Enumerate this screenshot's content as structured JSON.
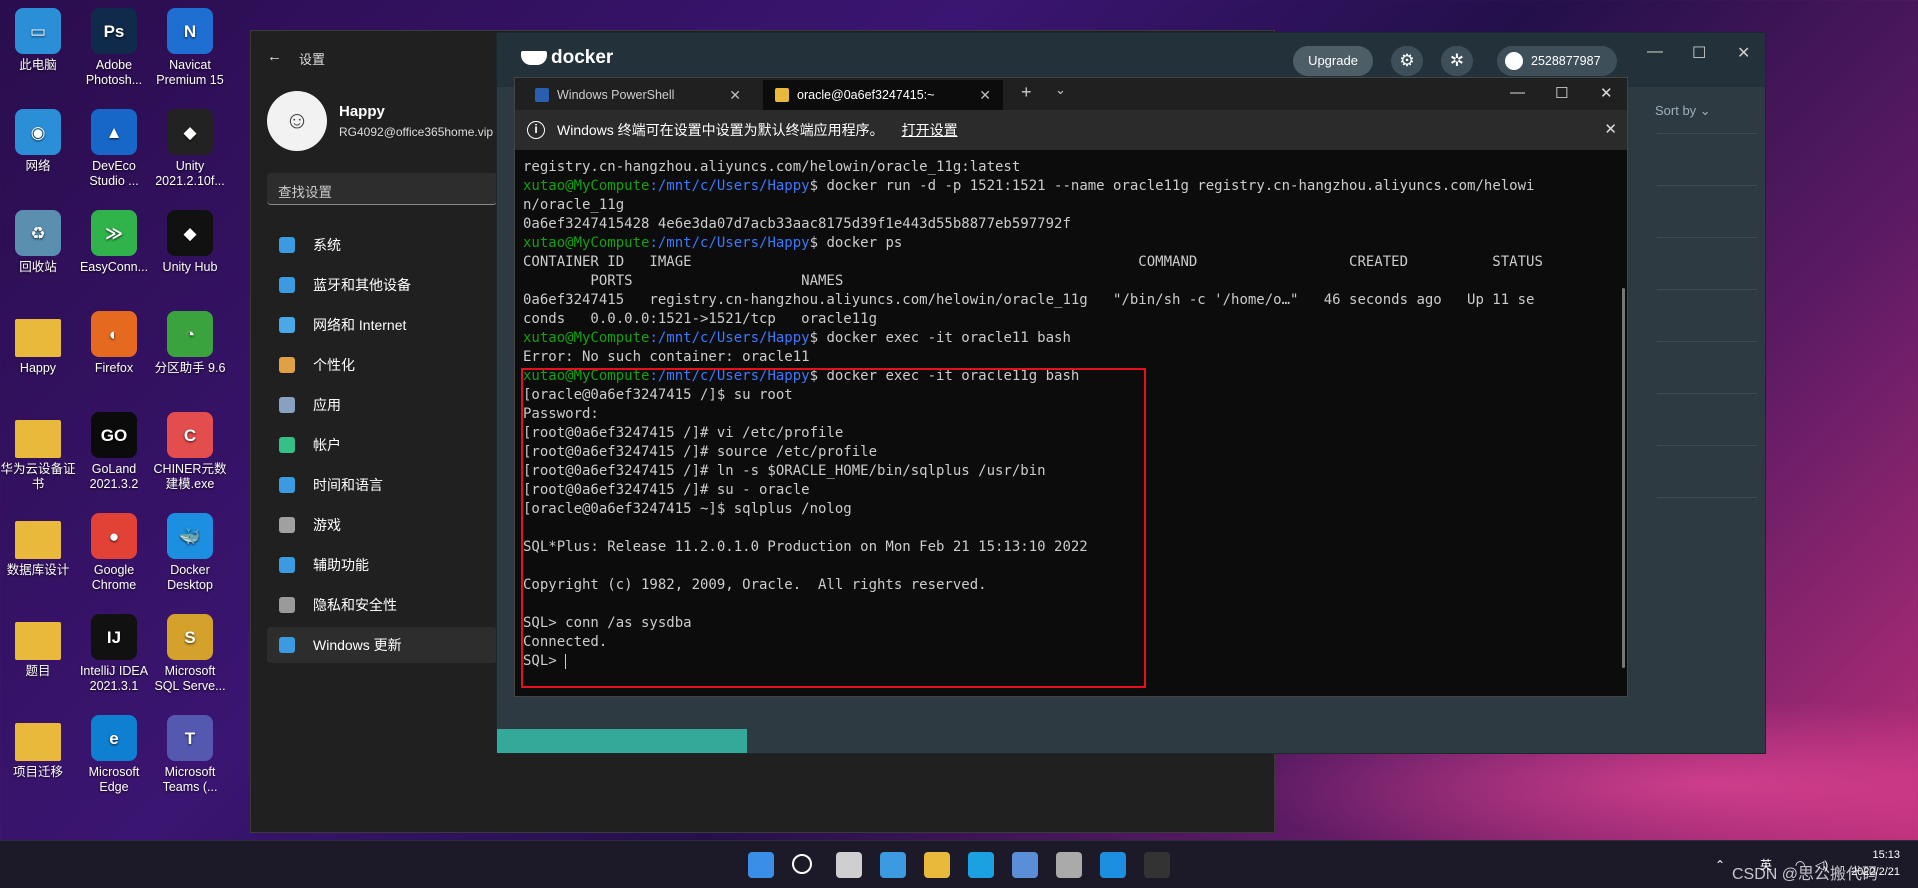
{
  "desktop": {
    "icons": [
      {
        "label": "此电脑",
        "color": "#2b8fd8",
        "glyph": "▭"
      },
      {
        "label": "Adobe Photosh...",
        "color": "#0f2a4a",
        "glyph": "Ps"
      },
      {
        "label": "Navicat Premium 15",
        "color": "#1e6fd1",
        "glyph": "N"
      },
      {
        "label": "网络",
        "color": "#2b8fd8",
        "glyph": "◉"
      },
      {
        "label": "DevEco Studio ...",
        "color": "#1767c9",
        "glyph": "▲"
      },
      {
        "label": "Unity 2021.2.10f...",
        "color": "#222222",
        "glyph": "◆"
      },
      {
        "label": "回收站",
        "color": "#5a8fb0",
        "glyph": "♻"
      },
      {
        "label": "EasyConn...",
        "color": "#2fb34a",
        "glyph": "≫"
      },
      {
        "label": "Unity Hub",
        "color": "#111111",
        "glyph": "◆"
      },
      {
        "label": "Happy",
        "color": "#e8b93a",
        "glyph": ""
      },
      {
        "label": "Firefox",
        "color": "#e56a1f",
        "glyph": "◐"
      },
      {
        "label": "分区助手 9.6",
        "color": "#3aa33e",
        "glyph": "◔"
      },
      {
        "label": "华为云设备证书",
        "color": "#e8b93a",
        "glyph": ""
      },
      {
        "label": "GoLand 2021.3.2",
        "color": "#0b0b0b",
        "glyph": "GO"
      },
      {
        "label": "CHINER元数建模.exe",
        "color": "#e34d4d",
        "glyph": "C"
      },
      {
        "label": "数据库设计",
        "color": "#e8b93a",
        "glyph": ""
      },
      {
        "label": "Google Chrome",
        "color": "#e24235",
        "glyph": "●"
      },
      {
        "label": "Docker Desktop",
        "color": "#1d8fe0",
        "glyph": "🐳"
      },
      {
        "label": "题目",
        "color": "#e8b93a",
        "glyph": ""
      },
      {
        "label": "IntelliJ IDEA 2021.3.1",
        "color": "#111111",
        "glyph": "IJ"
      },
      {
        "label": "Microsoft SQL Serve...",
        "color": "#d4a22a",
        "glyph": "S"
      },
      {
        "label": "项目迁移",
        "color": "#e8b93a",
        "glyph": ""
      },
      {
        "label": "Microsoft Edge",
        "color": "#0e7fd1",
        "glyph": "e"
      },
      {
        "label": "Microsoft Teams (...",
        "color": "#5558af",
        "glyph": "T"
      }
    ]
  },
  "settings": {
    "title": "设置",
    "user_name": "Happy",
    "user_email": "RG4092@office365home.vip",
    "search_placeholder": "查找设置",
    "nav": [
      {
        "label": "系统",
        "color": "#3b9ae0"
      },
      {
        "label": "蓝牙和其他设备",
        "color": "#3b9ae0"
      },
      {
        "label": "网络和 Internet",
        "color": "#4aa8e8"
      },
      {
        "label": "个性化",
        "color": "#e0a046"
      },
      {
        "label": "应用",
        "color": "#8aa0c0"
      },
      {
        "label": "帐户",
        "color": "#35c08a"
      },
      {
        "label": "时间和语言",
        "color": "#3b9ae0"
      },
      {
        "label": "游戏",
        "color": "#a0a0a0"
      },
      {
        "label": "辅助功能",
        "color": "#3b9ae0"
      },
      {
        "label": "隐私和安全性",
        "color": "#9a9a9a"
      },
      {
        "label": "Windows 更新",
        "color": "#3b9ae0",
        "active": true
      }
    ]
  },
  "docker": {
    "logo": "docker",
    "upgrade_label": "Upgrade",
    "user_id": "2528877987",
    "sort_label": "Sort by"
  },
  "terminal": {
    "tabs": [
      {
        "label": "Windows PowerShell",
        "color": "#2a5fb0"
      },
      {
        "label": "oracle@0a6ef3247415:~",
        "color": "#e8b93a"
      }
    ],
    "info_text": "Windows 终端可在设置中设置为默认终端应用程序。",
    "info_link": "打开设置",
    "prompt_user": "xutao@MyCompute",
    "prompt_path": ":/mnt/c/Users/Happy",
    "lines": [
      {
        "text": "registry.cn-hangzhou.aliyuncs.com/helowin/oracle_11g:latest"
      },
      {
        "prompt": true,
        "text": "$ docker run -d -p 1521:1521 --name oracle11g registry.cn-hangzhou.aliyuncs.com/helowi"
      },
      {
        "text": "n/oracle_11g"
      },
      {
        "text": "0a6ef3247415428 4e6e3da07d7acb33aac8175d39f1e443d55b8877eb597792f"
      },
      {
        "prompt": true,
        "text": "$ docker ps"
      },
      {
        "text": "CONTAINER ID   IMAGE                                                     COMMAND                  CREATED          STATUS"
      },
      {
        "text": "        PORTS                    NAMES"
      },
      {
        "text": "0a6ef3247415   registry.cn-hangzhou.aliyuncs.com/helowin/oracle_11g   \"/bin/sh -c '/home/o…\"   46 seconds ago   Up 11 se"
      },
      {
        "text": "conds   0.0.0.0:1521->1521/tcp   oracle11g"
      },
      {
        "prompt": true,
        "text": "$ docker exec -it oracle11 bash"
      },
      {
        "text": "Error: No such container: oracle11"
      },
      {
        "prompt": true,
        "text": "$ docker exec -it oracle11g bash"
      },
      {
        "text": "[oracle@0a6ef3247415 /]$ su root"
      },
      {
        "text": "Password:"
      },
      {
        "text": "[root@0a6ef3247415 /]# vi /etc/profile"
      },
      {
        "text": "[root@0a6ef3247415 /]# source /etc/profile"
      },
      {
        "text": "[root@0a6ef3247415 /]# ln -s $ORACLE_HOME/bin/sqlplus /usr/bin"
      },
      {
        "text": "[root@0a6ef3247415 /]# su - oracle"
      },
      {
        "text": "[oracle@0a6ef3247415 ~]$ sqlplus /nolog"
      },
      {
        "text": ""
      },
      {
        "text": "SQL*Plus: Release 11.2.0.1.0 Production on Mon Feb 21 15:13:10 2022"
      },
      {
        "text": ""
      },
      {
        "text": "Copyright (c) 1982, 2009, Oracle.  All rights reserved."
      },
      {
        "text": ""
      },
      {
        "text": "SQL> conn /as sysdba"
      },
      {
        "text": "Connected."
      },
      {
        "text": "SQL> ",
        "cursor": true
      }
    ]
  },
  "taskbar": {
    "apps": [
      {
        "name": "start-icon",
        "color": "#3a8ee6"
      },
      {
        "name": "search-icon",
        "color": "#ffffff"
      },
      {
        "name": "task-view-icon",
        "color": "#cfcfcf"
      },
      {
        "name": "widgets-icon",
        "color": "#3b9ae0"
      },
      {
        "name": "file-explorer-icon",
        "color": "#e8b93a"
      },
      {
        "name": "edge-icon",
        "color": "#1ba1e2"
      },
      {
        "name": "store-icon",
        "color": "#5a8fd8"
      },
      {
        "name": "settings-icon",
        "color": "#aaaaaa"
      },
      {
        "name": "docker-icon",
        "color": "#1d8fe0"
      },
      {
        "name": "terminal-icon",
        "color": "#333333"
      }
    ],
    "ime": "英",
    "time": "15:13",
    "date": "2022/2/21"
  },
  "watermark": "CSDN @思公搬代码"
}
